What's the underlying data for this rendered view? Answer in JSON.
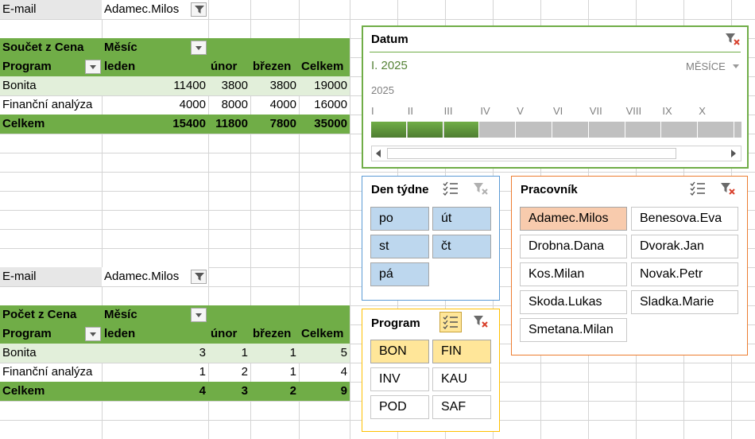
{
  "pivot1": {
    "filter_label": "E-mail",
    "filter_value": "Adamec.Milos",
    "value_label": "Součet z Cena",
    "col_label": "Měsíc",
    "row_label": "Program",
    "months": [
      "leden",
      "únor",
      "březen",
      "Celkem"
    ],
    "rows": [
      {
        "name": "Bonita",
        "values": [
          "11400",
          "3800",
          "3800",
          "19000"
        ]
      },
      {
        "name": "Finanční analýza",
        "values": [
          "4000",
          "8000",
          "4000",
          "16000"
        ]
      }
    ],
    "total": {
      "name": "Celkem",
      "values": [
        "15400",
        "11800",
        "7800",
        "35000"
      ]
    }
  },
  "pivot2": {
    "filter_label": "E-mail",
    "filter_value": "Adamec.Milos",
    "value_label": "Počet z Cena",
    "col_label": "Měsíc",
    "row_label": "Program",
    "months": [
      "leden",
      "únor",
      "březen",
      "Celkem"
    ],
    "rows": [
      {
        "name": "Bonita",
        "values": [
          "3",
          "1",
          "1",
          "5"
        ]
      },
      {
        "name": "Finanční analýza",
        "values": [
          "1",
          "2",
          "1",
          "4"
        ]
      }
    ],
    "total": {
      "name": "Celkem",
      "values": [
        "4",
        "3",
        "2",
        "9"
      ]
    }
  },
  "timeline": {
    "title": "Datum",
    "selection": "I. 2025",
    "level": "MĚSÍCE",
    "year": "2025",
    "months": [
      "I",
      "II",
      "III",
      "IV",
      "V",
      "VI",
      "VII",
      "VIII",
      "IX",
      "X"
    ],
    "selected_count": 3,
    "color": "#548235"
  },
  "slicer_den": {
    "title": "Den týdne",
    "items": [
      "po",
      "út",
      "st",
      "čt",
      "pá"
    ],
    "color": "#bdd7ee"
  },
  "slicer_pracovnik": {
    "title": "Pracovník",
    "items": [
      "Adamec.Milos",
      "Benesova.Eva",
      "Drobna.Dana",
      "Dvorak.Jan",
      "Kos.Milan",
      "Novak.Petr",
      "Skoda.Lukas",
      "Sladka.Marie",
      "Smetana.Milan"
    ],
    "selected": "Adamec.Milos",
    "color": "#f8cbad"
  },
  "slicer_program": {
    "title": "Program",
    "items": [
      "BON",
      "FIN",
      "INV",
      "KAU",
      "POD",
      "SAF"
    ],
    "selected": [
      "BON",
      "FIN"
    ],
    "color": "#ffe699"
  },
  "icons": [
    "filter-icon",
    "dropdown-arrow-icon",
    "clear-filter-icon",
    "multi-select-icon",
    "scroll-left-icon",
    "scroll-right-icon"
  ]
}
